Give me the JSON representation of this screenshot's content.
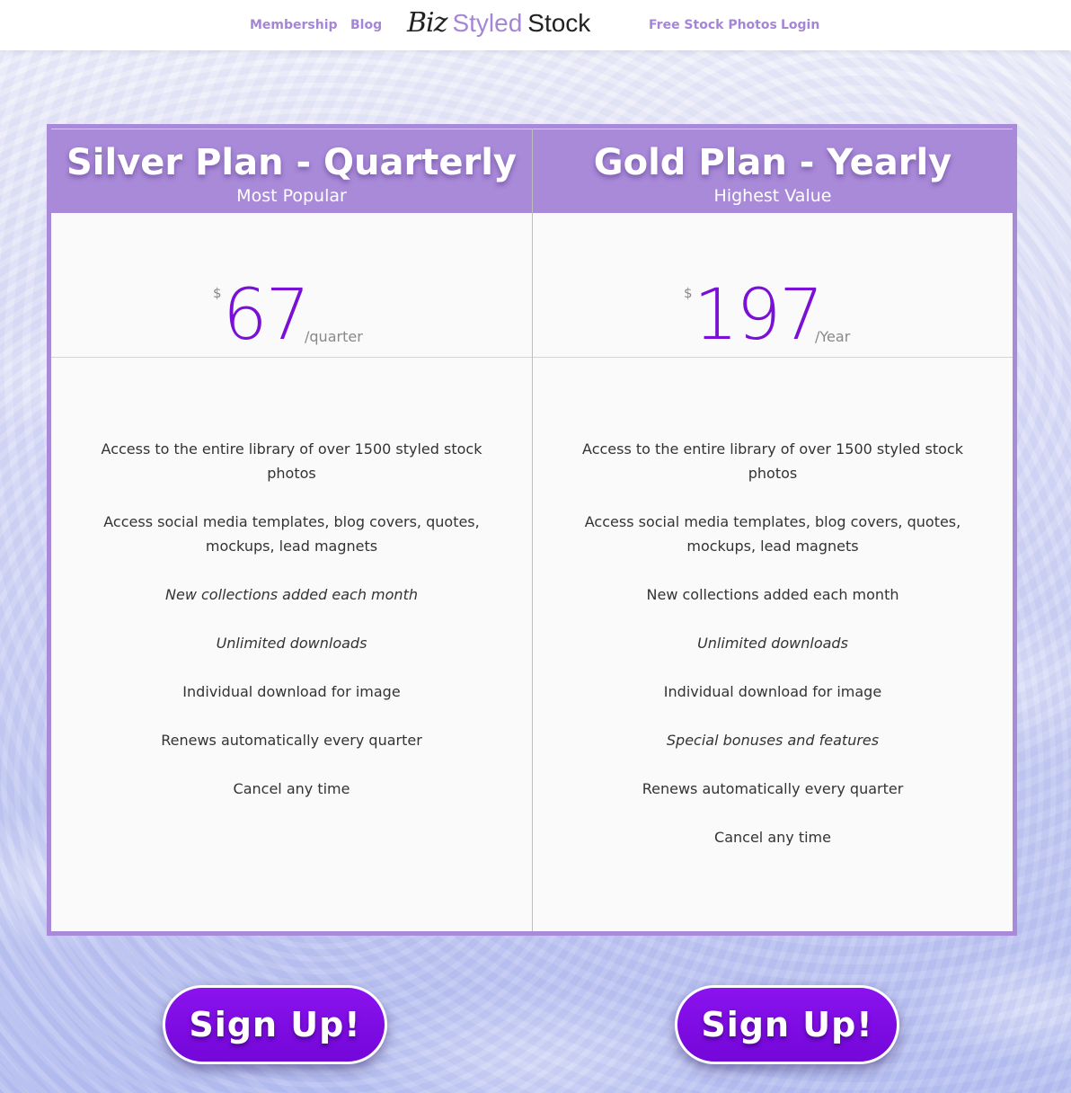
{
  "nav": {
    "links": [
      "Membership",
      "Blog",
      "Free Stock Photos",
      "Login"
    ],
    "logo": {
      "part1": "Biz",
      "part2": "Styled",
      "part3": "Stock"
    }
  },
  "plans": [
    {
      "title": "Silver Plan - Quarterly",
      "subtitle": "Most Popular",
      "currency": "$",
      "amount": "67",
      "period": "/quarter",
      "features": [
        "Access to the entire library of over 1500 styled stock photos",
        "Access social media templates, blog covers, quotes, mockups, lead magnets",
        "New collections added each month",
        "Unlimited downloads",
        "Individual download for image",
        "Renews automatically every quarter",
        "Cancel any time"
      ],
      "button": "Sign Up!"
    },
    {
      "title": "Gold Plan - Yearly",
      "subtitle": "Highest Value",
      "currency": "$",
      "amount": "197",
      "period": "/Year",
      "features": [
        "Access to the entire library of over 1500 styled stock photos",
        "Access social media templates, blog covers, quotes, mockups, lead magnets",
        "New collections added each month",
        "Unlimited downloads",
        "Individual download for image",
        "Special bonuses and features",
        "Renews automatically every quarter",
        "Cancel any time"
      ],
      "button": "Sign Up!"
    }
  ],
  "colors": {
    "accent": "#a98ad9",
    "price": "#7a10d6",
    "button": "#7f0ce3"
  }
}
